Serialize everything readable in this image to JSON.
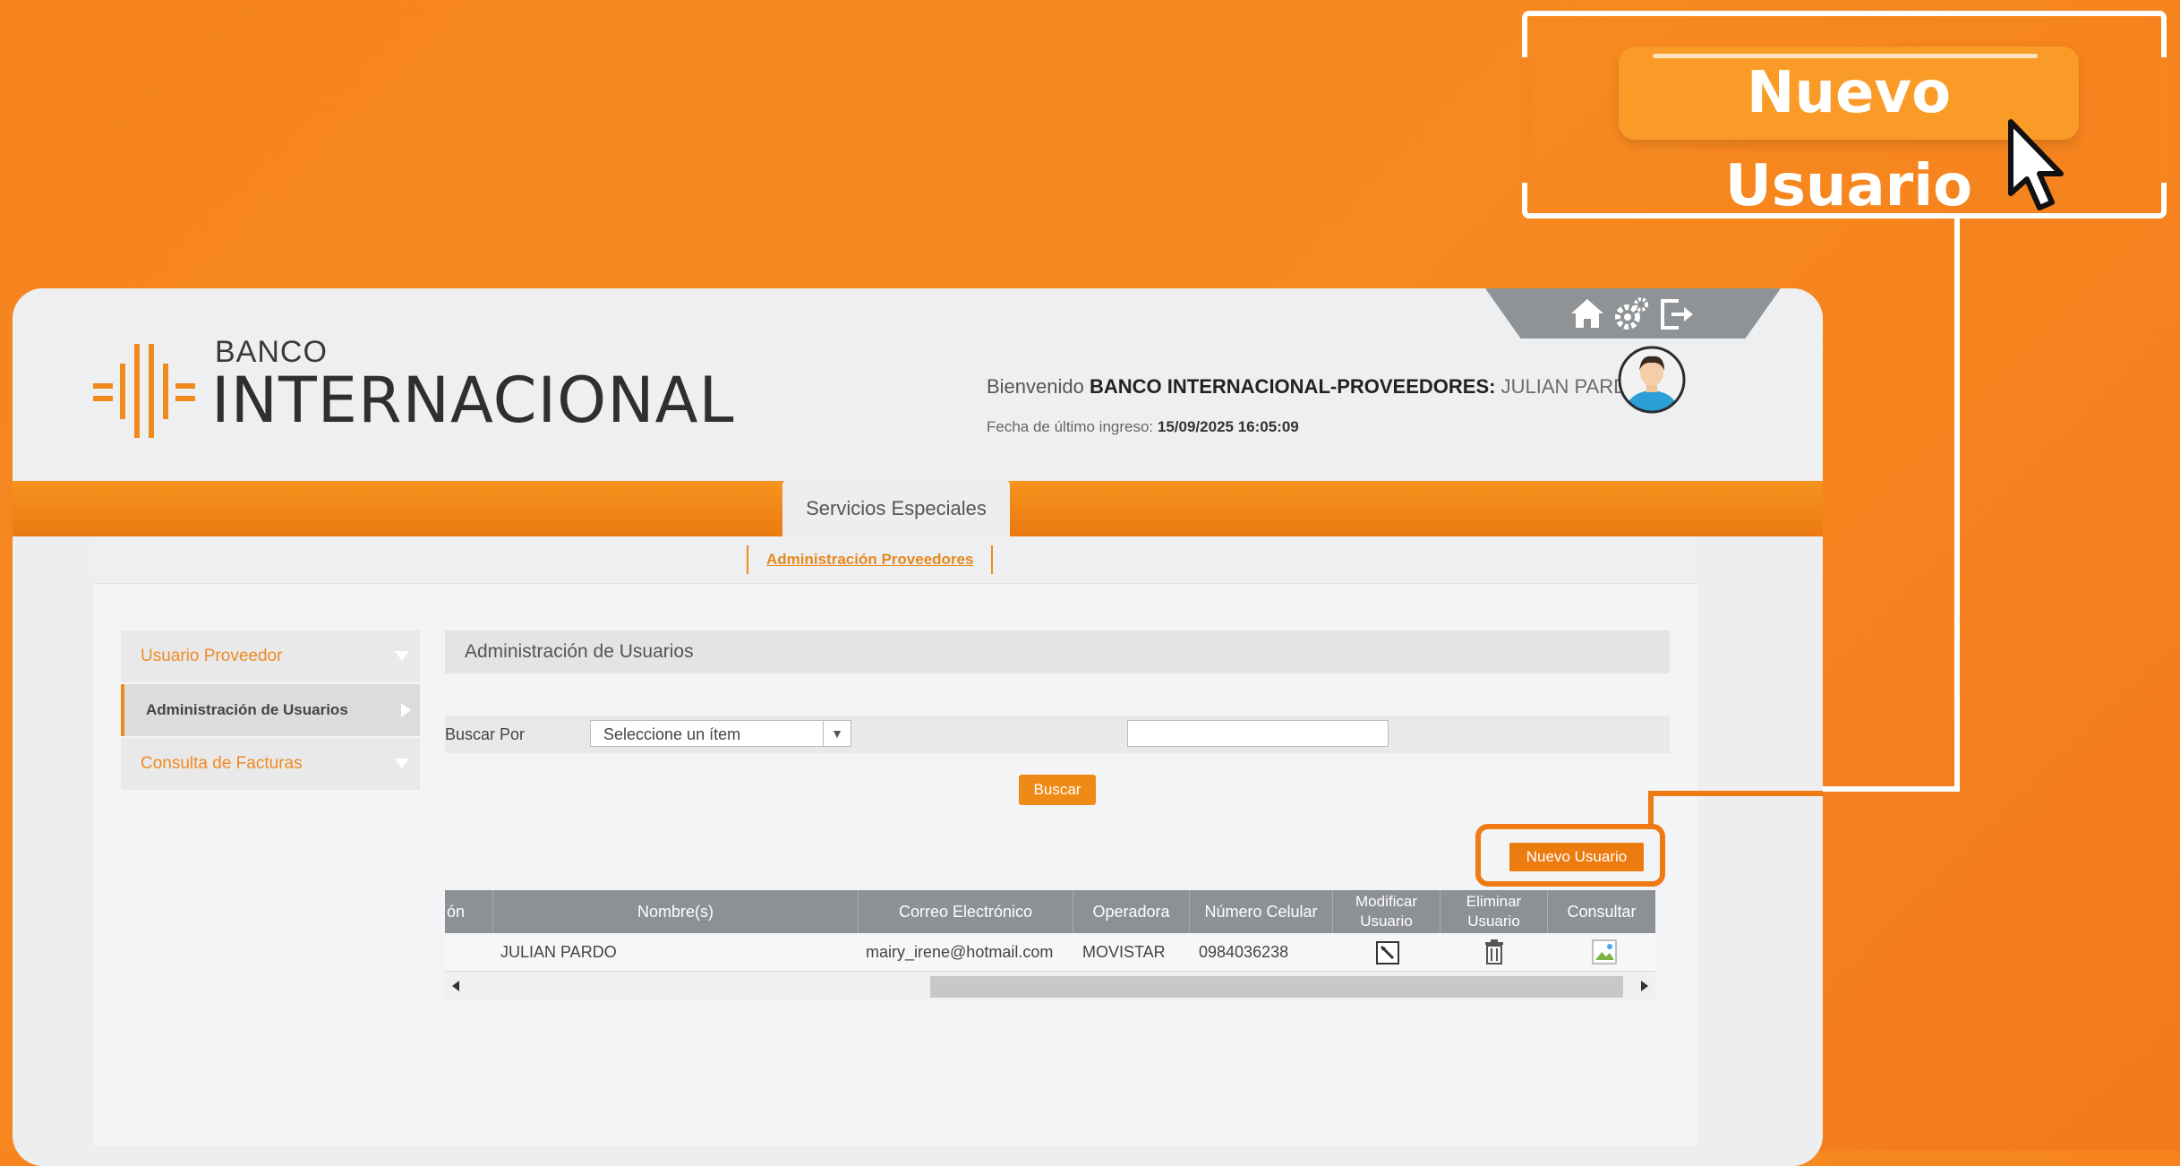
{
  "callout": {
    "button_label": "Nuevo Usuario"
  },
  "header": {
    "logo_banco": "BANCO",
    "logo_name": "INTERNACIONAL",
    "welcome_prefix": "Bienvenido",
    "company": "BANCO INTERNACIONAL-PROVEEDORES:",
    "user_name": "JULIAN PARDO",
    "last_login_label": "Fecha de último ingreso:",
    "last_login_value": "15/09/2025 16:05:09",
    "icons": [
      "home-icon",
      "settings-icon",
      "logout-icon"
    ]
  },
  "nav": {
    "main_tab": "Servicios Especiales",
    "sub_tab": "Administración Proveedores"
  },
  "sidebar": {
    "items": [
      {
        "label": "Usuario Proveedor"
      },
      {
        "label": "Administración de Usuarios"
      },
      {
        "label": "Consulta de Facturas"
      }
    ]
  },
  "main": {
    "title": "Administración de Usuarios",
    "search_label": "Buscar Por",
    "select_value": "Seleccione un ítem",
    "search_button": "Buscar",
    "new_user_button": "Nuevo Usuario"
  },
  "table": {
    "headers": [
      "ón",
      "Nombre(s)",
      "Correo Electrónico",
      "Operadora",
      "Número Celular",
      "Modificar Usuario",
      "Eliminar Usuario",
      "Consultar"
    ],
    "rows": [
      {
        "nombre": "JULIAN PARDO",
        "correo": "mairy_irene@hotmail.com",
        "operadora": "MOVISTAR",
        "celular": "0984036238"
      }
    ]
  },
  "colors": {
    "brand_orange": "#f08a1c",
    "background": "#f6861f"
  }
}
